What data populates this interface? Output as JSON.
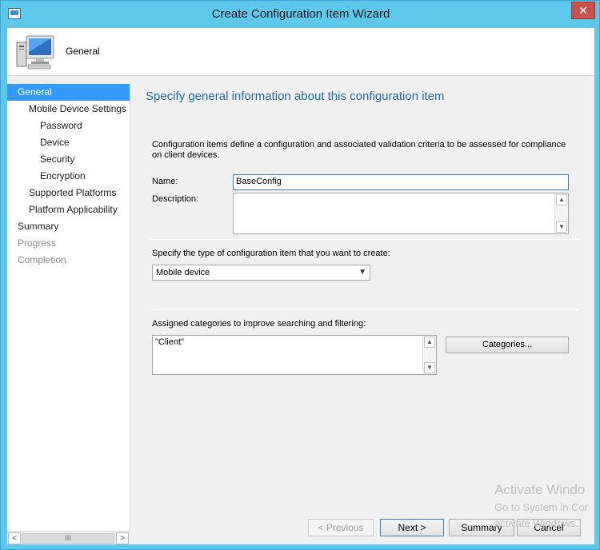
{
  "window": {
    "title": "Create Configuration Item Wizard",
    "close_glyph": "✕"
  },
  "header": {
    "title": "General",
    "icon": "computer-icon"
  },
  "nav": {
    "items": [
      {
        "label": "General",
        "level": 0,
        "state": "selected"
      },
      {
        "label": "Mobile Device Settings",
        "level": 1,
        "state": "normal"
      },
      {
        "label": "Password",
        "level": 2,
        "state": "normal"
      },
      {
        "label": "Device",
        "level": 2,
        "state": "normal"
      },
      {
        "label": "Security",
        "level": 2,
        "state": "normal"
      },
      {
        "label": "Encryption",
        "level": 2,
        "state": "normal"
      },
      {
        "label": "Supported Platforms",
        "level": 1,
        "state": "normal"
      },
      {
        "label": "Platform Applicability",
        "level": 1,
        "state": "normal"
      },
      {
        "label": "Summary",
        "level": 0,
        "state": "normal"
      },
      {
        "label": "Progress",
        "level": 0,
        "state": "disabled"
      },
      {
        "label": "Completion",
        "level": 0,
        "state": "disabled"
      }
    ],
    "scroll_left": "<",
    "scroll_right": ">",
    "scroll_grip": "III"
  },
  "main": {
    "heading": "Specify general information about this configuration item",
    "description": "Configuration items define a configuration and associated validation criteria to be assessed for compliance on client devices.",
    "name_label": "Name:",
    "name_value": "BaseConfig",
    "description_label": "Description:",
    "description_value": "",
    "type_label": "Specify the type of configuration item that you want to create:",
    "type_selected": "Mobile device",
    "categories_label": "Assigned categories to improve searching and filtering:",
    "categories_value": "\"Client\"",
    "categories_button": "Categories..."
  },
  "footer": {
    "previous": "< Previous",
    "next": "Next >",
    "summary": "Summary",
    "cancel": "Cancel"
  },
  "watermark": {
    "line1": "Activate Windo",
    "line2": "Go to System in Cor",
    "line3": "activate Windows."
  },
  "colors": {
    "frame": "#5ec8ec",
    "selection": "#3399ff",
    "heading": "#1e6aa8"
  }
}
